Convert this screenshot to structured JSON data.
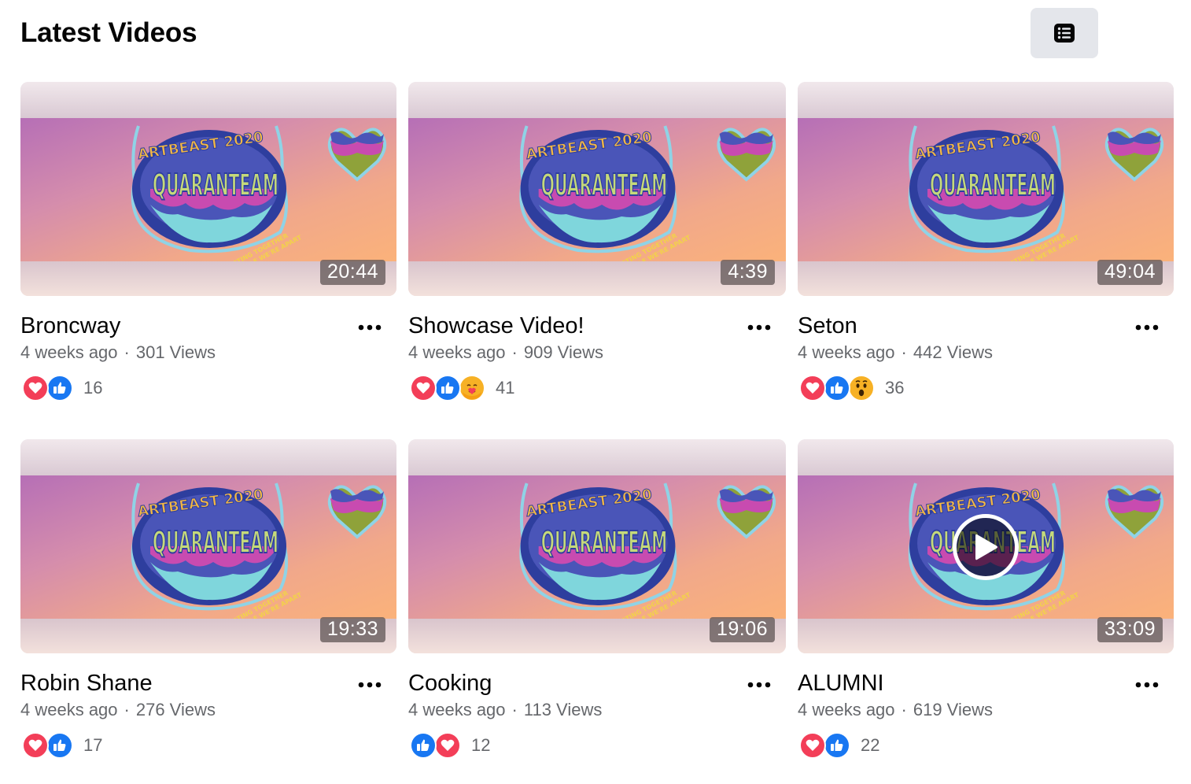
{
  "header": {
    "title": "Latest Videos",
    "list_view_icon": "list-icon",
    "grid_view_icon": "grid-icon",
    "active_view": "grid"
  },
  "colors": {
    "accent": "#1877f2",
    "love": "#f33e58",
    "secondary_text": "#65676b",
    "active_toggle_bg": "#e7f3ff",
    "inactive_toggle_bg": "#e4e6eb"
  },
  "thumbnail": {
    "line1": "ARTBEAST 2020",
    "line2": "QUARANTEAM",
    "tagline1": "CREATING TOGETHER",
    "tagline2": "WHILE WE'RE APART"
  },
  "videos": [
    {
      "title": "Broncway",
      "age": "4 weeks ago",
      "views": "301 Views",
      "duration": "20:44",
      "reactions": [
        "love",
        "like"
      ],
      "reaction_count": "16"
    },
    {
      "title": "Showcase Video!",
      "age": "4 weeks ago",
      "views": "909 Views",
      "duration": "4:39",
      "reactions": [
        "love",
        "like",
        "care"
      ],
      "reaction_count": "41"
    },
    {
      "title": "Seton",
      "age": "4 weeks ago",
      "views": "442 Views",
      "duration": "49:04",
      "reactions": [
        "love",
        "like",
        "wow"
      ],
      "reaction_count": "36"
    },
    {
      "title": "Robin Shane",
      "age": "4 weeks ago",
      "views": "276 Views",
      "duration": "19:33",
      "reactions": [
        "love",
        "like"
      ],
      "reaction_count": "17"
    },
    {
      "title": "Cooking",
      "age": "4 weeks ago",
      "views": "113 Views",
      "duration": "19:06",
      "reactions": [
        "like",
        "love"
      ],
      "reaction_count": "12"
    },
    {
      "title": "ALUMNI",
      "age": "4 weeks ago",
      "views": "619 Views",
      "duration": "33:09",
      "reactions": [
        "love",
        "like"
      ],
      "reaction_count": "22",
      "hovered": true
    }
  ]
}
